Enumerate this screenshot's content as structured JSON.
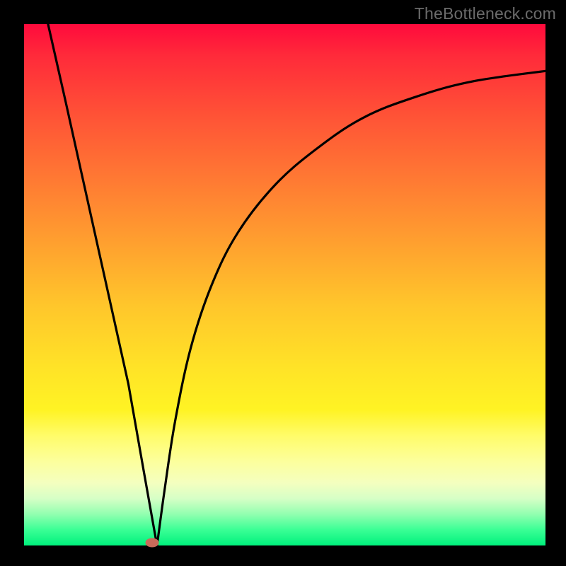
{
  "watermark": "TheBottleneck.com",
  "colors": {
    "frame": "#000000",
    "curve": "#000000",
    "marker": "#c96a5a",
    "gradient_top": "#ff0a3c",
    "gradient_bottom": "#00f07c"
  },
  "chart_data": {
    "type": "line",
    "title": "",
    "xlabel": "",
    "ylabel": "",
    "xlim": [
      0,
      100
    ],
    "ylim": [
      0,
      100
    ],
    "grid": false,
    "legend": null,
    "series": [
      {
        "name": "curve-left",
        "x": [
          4.6,
          8,
          12,
          16,
          20,
          23,
          25.5
        ],
        "y": [
          100,
          85,
          67,
          49,
          31,
          14,
          0
        ]
      },
      {
        "name": "curve-right",
        "x": [
          25.5,
          27,
          29,
          32,
          36,
          41,
          48,
          56,
          65,
          75,
          86,
          100
        ],
        "y": [
          0,
          11,
          24,
          38,
          50,
          60,
          69,
          76,
          82,
          86,
          89,
          91
        ]
      }
    ],
    "marker": {
      "x": 24.5,
      "y": 0.6
    },
    "notes": "Axes are unlabeled in the source image; values are normalized 0–100 estimates read from the plot geometry. The curve has a sharp V-shaped minimum near x≈25.5 touching y≈0, a near-linear left branch starting at the top-left corner, and a concave right branch asymptoting toward y≈91 at the right edge."
  }
}
